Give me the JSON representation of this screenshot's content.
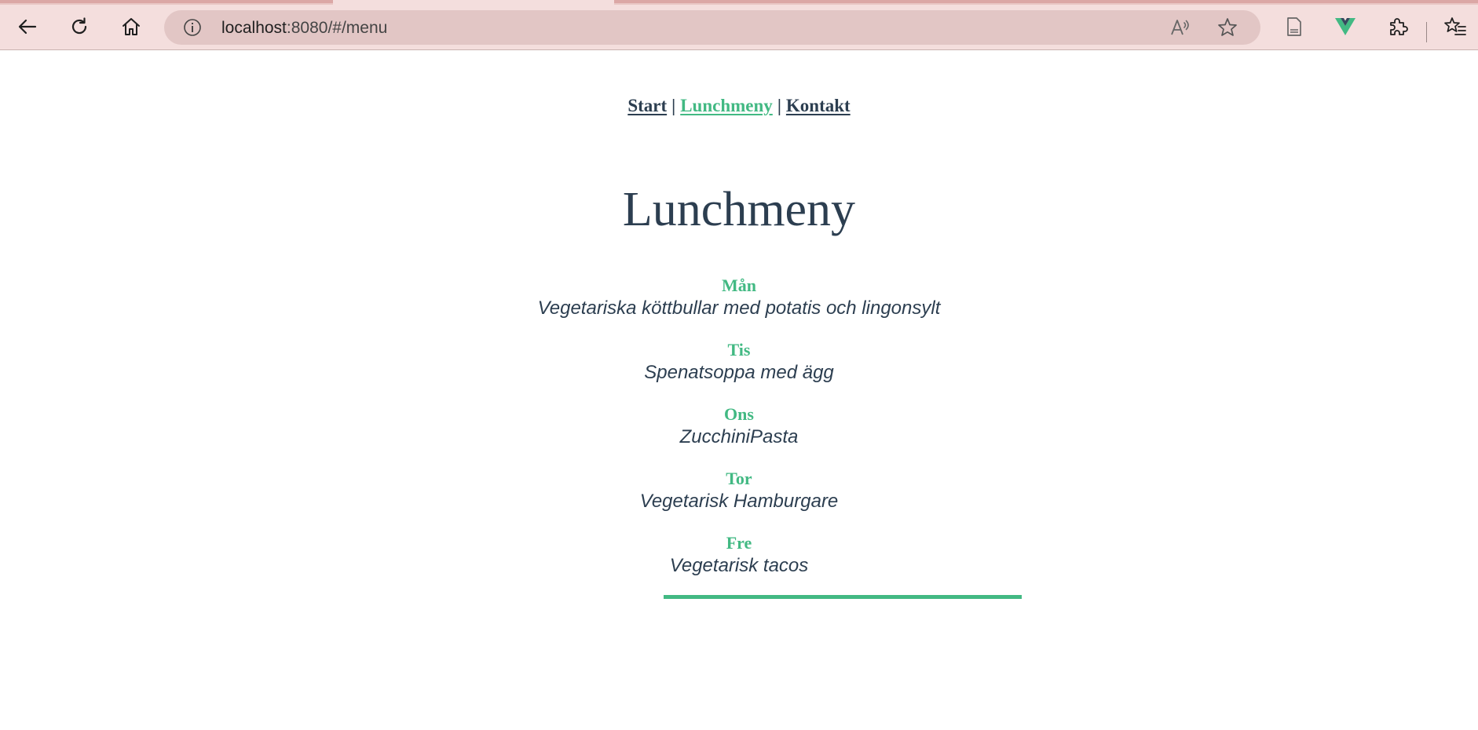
{
  "browser": {
    "url_host": "localhost",
    "url_rest": ":8080/#/menu",
    "icons": {
      "back": "back-arrow-icon",
      "reload": "reload-icon",
      "home": "home-icon",
      "info": "info-icon",
      "read_aloud": "read-aloud-icon",
      "favorite": "star-icon",
      "page": "document-icon",
      "vue_devtools": "vue-logo-icon",
      "extensions": "puzzle-icon",
      "favorites": "favorites-icon"
    },
    "accent": "#42b983"
  },
  "nav": {
    "items": [
      {
        "label": "Start"
      },
      {
        "label": "Lunchmeny"
      },
      {
        "label": "Kontakt"
      }
    ],
    "separator": "|",
    "active_index": 1
  },
  "page": {
    "title": "Lunchmeny",
    "menu": [
      {
        "day": "Mån",
        "dish": "Vegetariska köttbullar med potatis och lingonsylt"
      },
      {
        "day": "Tis",
        "dish": "Spenatsoppa med ägg"
      },
      {
        "day": "Ons",
        "dish": "ZucchiniPasta"
      },
      {
        "day": "Tor",
        "dish": "Vegetarisk Hamburgare"
      },
      {
        "day": "Fre",
        "dish": "Vegetarisk tacos"
      }
    ]
  },
  "colors": {
    "text": "#2c3e50",
    "accent": "#42b983",
    "chrome": "#f4dedd"
  }
}
